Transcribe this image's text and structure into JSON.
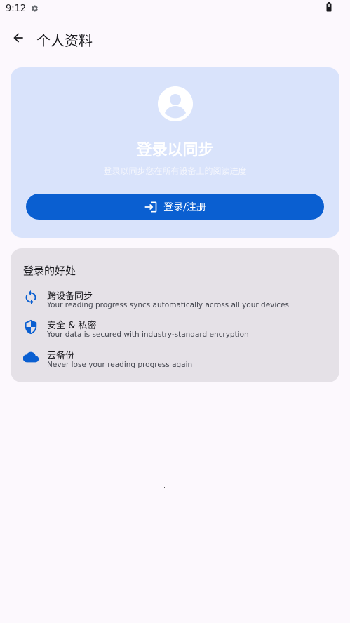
{
  "status_bar": {
    "time": "9:12",
    "icons": [
      "settings-gear-icon",
      "battery-icon"
    ]
  },
  "app_bar": {
    "back_icon": "arrow-back-icon",
    "title": "个人资料"
  },
  "login_card": {
    "avatar_icon": "account-circle-icon",
    "title": "登录以同步",
    "subtitle": "登录以同步您在所有设备上的阅读进度",
    "button_icon": "login-icon",
    "button_label": "登录/注册",
    "background_color": "#d9e3fb",
    "button_color": "#0a5fd1"
  },
  "benefits": {
    "title": "登录的好处",
    "items": [
      {
        "icon": "sync-icon",
        "title": "跨设备同步",
        "description": "Your reading progress syncs automatically across all your devices"
      },
      {
        "icon": "shield-icon",
        "title": "安全 & 私密",
        "description": "Your data is secured with industry-standard encryption"
      },
      {
        "icon": "cloud-icon",
        "title": "云备份",
        "description": "Never lose your reading progress again"
      }
    ],
    "accent_color": "#0a5fd1"
  }
}
